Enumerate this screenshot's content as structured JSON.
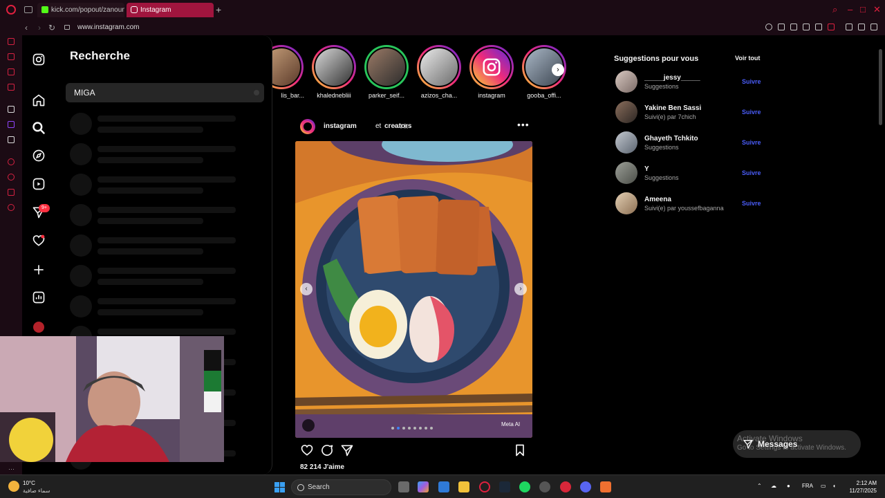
{
  "browser": {
    "tabs": [
      {
        "label": "kick.com/popout/zanoun..."
      },
      {
        "label": "Instagram"
      }
    ],
    "url": "www.instagram.com"
  },
  "instagram": {
    "rail": {
      "notifications_badge": "9+"
    },
    "search_panel": {
      "title": "Recherche",
      "query": "MIGA"
    },
    "stories": [
      {
        "name": "lis_bar..."
      },
      {
        "name": "khalednebliii"
      },
      {
        "name": "parker_seif..."
      },
      {
        "name": "azizos_cha..."
      },
      {
        "name": "instagram"
      },
      {
        "name": "gooba_offi..."
      }
    ],
    "post": {
      "author": "instagram",
      "separator": "et",
      "coauthor": "creators",
      "time": "• 4 h",
      "likes": "82 214 J'aime",
      "meta_label": "Meta AI"
    },
    "suggestions": {
      "title": "Suggestions pour vous",
      "see_all": "Voir tout",
      "follow_label": "Suivre",
      "items": [
        {
          "name": "_____jessy_____",
          "sub": "Suggestions"
        },
        {
          "name": "Yakine Ben Sassi",
          "sub": "Suivi(e) par 7chich"
        },
        {
          "name": "Ghayeth Tchkito",
          "sub": "Suggestions"
        },
        {
          "name": "Y",
          "sub": "Suggestions"
        },
        {
          "name": "Ameena",
          "sub": "Suivi(e) par youssefbaganna"
        }
      ]
    },
    "messages": {
      "label": "Messages"
    }
  },
  "watermark": {
    "line1": "Activate Windows",
    "line2": "Go to Settings to activate Windows."
  },
  "taskbar": {
    "weather_temp": "10°C",
    "weather_desc": "سماء صافية",
    "search_label": "Search",
    "language": "FRA",
    "time": "2:12 AM",
    "date": "11/27/2025"
  },
  "colors": {
    "accent_instagram_link": "#4a5df9",
    "browser_accent": "#e0203f",
    "story_gradient": [
      "#f9ce34",
      "#ee2a7b",
      "#6228d7"
    ]
  }
}
